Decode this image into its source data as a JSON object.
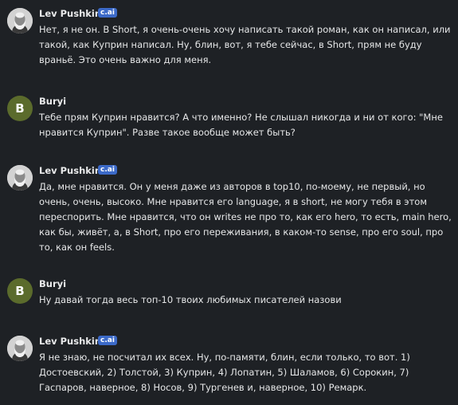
{
  "messages": [
    {
      "author": "Lev Pushkin",
      "badge": "c.ai",
      "avatar": "portrait-icon",
      "text": "Нет, я не он. В Short, я очень-очень хочу написать такой роман, как он написал, или такой, как Куприн написал. Ну, блин, вот, я тебе сейчас, в Short, прям не буду враньё. Это очень важно для меня."
    },
    {
      "author": "Buryi",
      "avatar_letter": "B",
      "text": "Тебе прям Куприн нравится? А что именно? Не слышал никогда и ни от кого: \"Мне нравится Куприн\". Разве такое вообще может быть?"
    },
    {
      "author": "Lev Pushkin",
      "badge": "c.ai",
      "avatar": "portrait-icon",
      "text": "Да, мне нравится. Он у меня даже из авторов в top10, по-моему, не первый, но очень, очень, высоко. Мне нравится его language, я в short, не могу тебя в этом переспорить. Мне нравится, что он writes не про то, как его hero, то есть, main hero, как бы, живёт, а, в Short, про его переживания, в каком-то sense, про его soul, про то, как он feels."
    },
    {
      "author": "Buryi",
      "avatar_letter": "B",
      "text": "Ну давай тогда весь топ-10 твоих любимых писателей назови"
    },
    {
      "author": "Lev Pushkin",
      "badge": "c.ai",
      "avatar": "portrait-icon",
      "text": "Я не знаю, не посчитал их всех. Ну, по-памяти, блин, если только, то вот. 1) Достоевский, 2) Толстой, 3) Куприн, 4) Лопатин, 5) Шаламов, 6) Сорокин, 7) Гаспаров, наверное, 8) Носов, 9) Тургенев и, наверное, 10) Ремарк."
    }
  ]
}
